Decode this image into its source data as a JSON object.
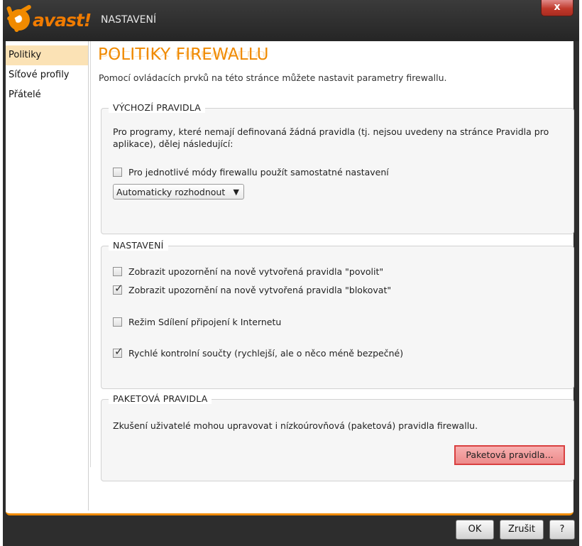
{
  "window": {
    "title": "NASTAVENÍ",
    "close_label": "x",
    "logo_text": "avast!"
  },
  "sidebar": {
    "items": [
      {
        "label": "Politiky"
      },
      {
        "label": "Síťové profily"
      },
      {
        "label": "Přátelé"
      }
    ]
  },
  "main": {
    "heading": "POLITIKY FIREWALLU",
    "subtitle": "Pomocí ovládacích prvků na této stránce můžete nastavit parametry firewallu.",
    "default_rules": {
      "legend": "VÝCHOZÍ PRAVIDLA",
      "description_line1": "Pro programy, které nemají definovaná žádná pravidla (tj. nejsou uvedeny na stránce Pravidla pro",
      "description_line2": "aplikace), dělej následující:",
      "separate_settings": {
        "label": "Pro jednotlivé módy firewallu použít samostatné nastavení",
        "checked": false
      },
      "action_select": {
        "value": "Automaticky rozhodnout"
      }
    },
    "settings": {
      "legend": "NASTAVENÍ",
      "options": [
        {
          "label": "Zobrazit upozornění na nově vytvořená pravidla \"povolit\"",
          "checked": false
        },
        {
          "label": "Zobrazit upozornění na nově vytvořená pravidla \"blokovat\"",
          "checked": true
        },
        {
          "label": "Režim Sdílení připojení k Internetu",
          "checked": false
        },
        {
          "label": "Rychlé kontrolní součty (rychlejší, ale o něco méně bezpečné)",
          "checked": true
        }
      ]
    },
    "packet_rules": {
      "legend": "PAKETOVÁ PRAVIDLA",
      "description": "Zkušení uživatelé mohou upravovat i nízkoúrovňová (paketová) pravidla firewallu.",
      "button_label": "Paketová pravidla..."
    }
  },
  "footer": {
    "ok_label": "OK",
    "cancel_label": "Zrušit",
    "help_label": "?"
  },
  "colors": {
    "accent": "#f08a00",
    "active_sidebar": "#fbe2b5",
    "highlight_button": "#ed8a8a"
  }
}
